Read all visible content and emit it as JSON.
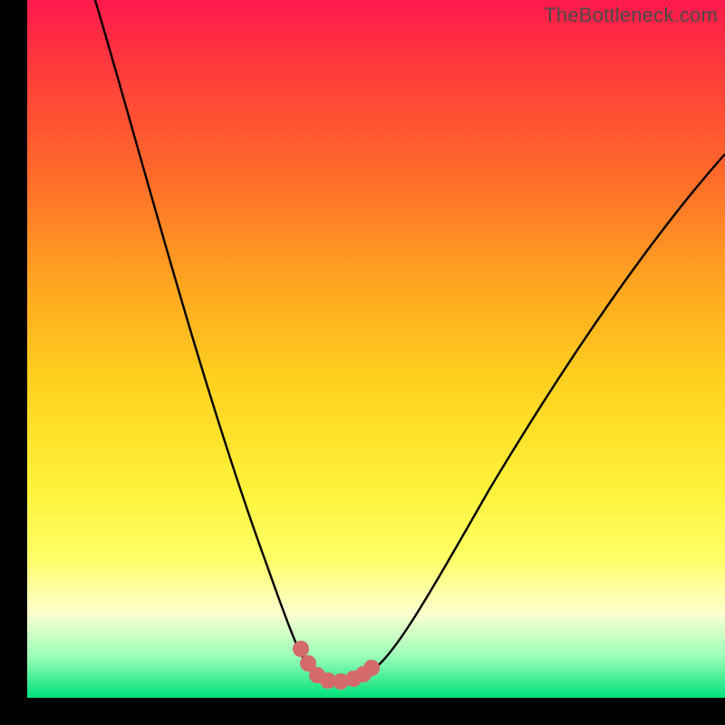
{
  "watermark": "TheBottleneck.com",
  "chart_data": {
    "type": "line",
    "title": "",
    "xlabel": "",
    "ylabel": "",
    "xlim": [
      0,
      100
    ],
    "ylim": [
      0,
      100
    ],
    "series": [
      {
        "name": "bottleneck-curve",
        "x": [
          10,
          15,
          20,
          25,
          30,
          35,
          38,
          40,
          42,
          44,
          46,
          48,
          50,
          55,
          60,
          65,
          70,
          80,
          90,
          100
        ],
        "y": [
          100,
          86,
          72,
          58,
          44,
          28,
          16,
          8,
          3,
          1,
          1,
          1,
          3,
          10,
          20,
          30,
          40,
          55,
          68,
          78
        ]
      }
    ],
    "markers": {
      "name": "highlight-points",
      "color": "#d86a6a",
      "radius_px": 9,
      "x": [
        39.5,
        40.5,
        41.5,
        43,
        45,
        47,
        48,
        49
      ],
      "y": [
        6,
        4,
        2.5,
        1,
        1,
        2,
        3.5,
        5
      ]
    }
  }
}
